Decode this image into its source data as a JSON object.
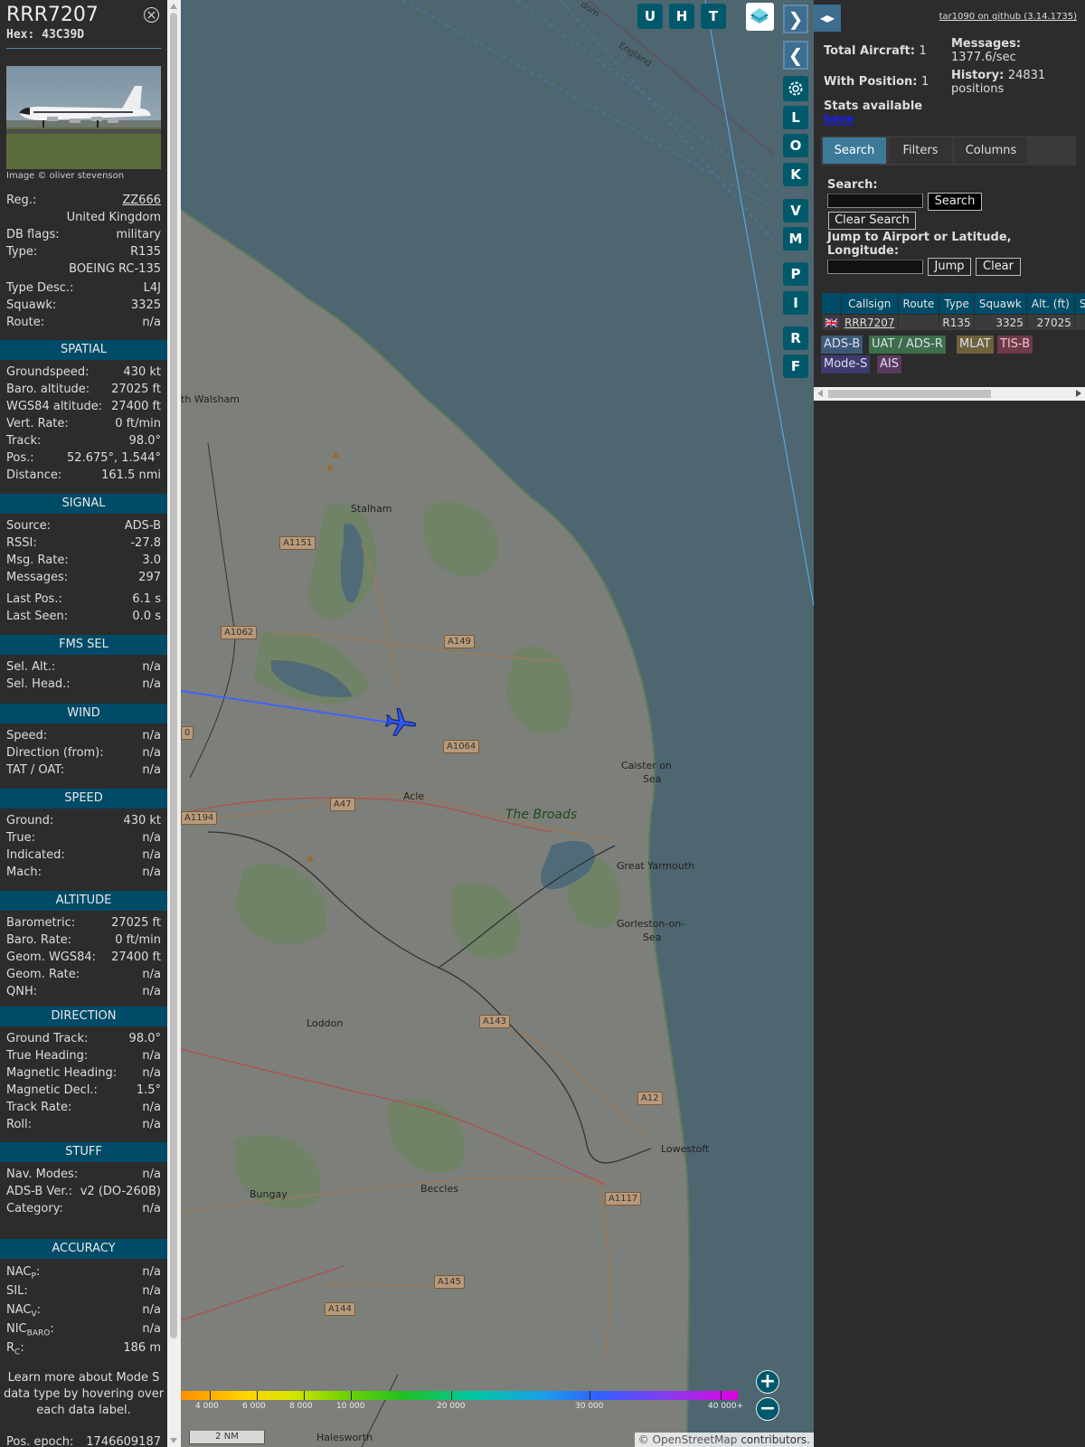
{
  "aircraft": {
    "callsign": "RRR7207",
    "hex_label": "Hex:",
    "hex": "43C39D",
    "photo_credit": "Image © oliver stevenson"
  },
  "details": [
    {
      "label": "Reg.:",
      "value": "ZZ666",
      "link": true
    },
    {
      "full": "United Kingdom"
    },
    {
      "label": "DB flags:",
      "value": "military"
    },
    {
      "label": "Type:",
      "value": "R135"
    },
    {
      "full": "BOEING RC-135"
    },
    {
      "label": "Type Desc.:",
      "value": "L4J"
    },
    {
      "label": "Squawk:",
      "value": "3325"
    },
    {
      "label": "Route:",
      "value": "n/a"
    }
  ],
  "sections": [
    {
      "title": "SPATIAL",
      "rows": [
        {
          "label": "Groundspeed:",
          "value": "430 kt"
        },
        {
          "label": "Baro. altitude:",
          "value": "27025 ft"
        },
        {
          "label": "WGS84 altitude:",
          "value": "27400 ft"
        },
        {
          "label": "Vert. Rate:",
          "value": "0 ft/min"
        },
        {
          "label": "Track:",
          "value": "98.0°"
        },
        {
          "label": "Pos.:",
          "value": "52.675°, 1.544°"
        },
        {
          "label": "Distance:",
          "value": "161.5 nmi"
        }
      ]
    },
    {
      "title": "SIGNAL",
      "rows": [
        {
          "label": "Source:",
          "value": "ADS-B"
        },
        {
          "label": "RSSI:",
          "value": "-27.8"
        },
        {
          "label": "Msg. Rate:",
          "value": "3.0"
        },
        {
          "label": "Messages:",
          "value": "297"
        },
        {
          "label": "Last Pos.:",
          "value": "6.1 s"
        },
        {
          "label": "Last Seen:",
          "value": "0.0 s"
        }
      ]
    },
    {
      "title": "FMS SEL",
      "rows": [
        {
          "label": "Sel. Alt.:",
          "value": "n/a"
        },
        {
          "label": "Sel. Head.:",
          "value": "n/a"
        }
      ]
    },
    {
      "title": "WIND",
      "rows": [
        {
          "label": "Speed:",
          "value": "n/a"
        },
        {
          "label": "Direction (from):",
          "value": "n/a"
        },
        {
          "label": "TAT / OAT:",
          "value": "n/a"
        }
      ]
    },
    {
      "title": "SPEED",
      "rows": [
        {
          "label": "Ground:",
          "value": "430 kt"
        },
        {
          "label": "True:",
          "value": "n/a"
        },
        {
          "label": "Indicated:",
          "value": "n/a"
        },
        {
          "label": "Mach:",
          "value": "n/a"
        }
      ]
    },
    {
      "title": "ALTITUDE",
      "rows": [
        {
          "label": "Barometric:",
          "value": "27025 ft"
        },
        {
          "label": "Baro. Rate:",
          "value": "0 ft/min"
        },
        {
          "label": "Geom. WGS84:",
          "value": "27400 ft"
        },
        {
          "label": "Geom. Rate:",
          "value": "n/a"
        },
        {
          "label": "QNH:",
          "value": "n/a"
        }
      ]
    },
    {
      "title": "DIRECTION",
      "rows": [
        {
          "label": "Ground Track:",
          "value": "98.0°"
        },
        {
          "label": "True Heading:",
          "value": "n/a"
        },
        {
          "label": "Magnetic Heading:",
          "value": "n/a"
        },
        {
          "label": "Magnetic Decl.:",
          "value": "1.5°"
        },
        {
          "label": "Track Rate:",
          "value": "n/a"
        },
        {
          "label": "Roll:",
          "value": "n/a"
        }
      ]
    },
    {
      "title": "STUFF",
      "rows": [
        {
          "label": "Nav. Modes:",
          "value": "n/a"
        },
        {
          "label": "ADS-B Ver.:",
          "value": "v2 (DO-260B)"
        },
        {
          "label": "Category:",
          "value": "n/a"
        }
      ]
    },
    {
      "title": "ACCURACY",
      "rows": [
        {
          "label": "NACP:",
          "value": "n/a"
        },
        {
          "label": "SIL:",
          "value": "n/a"
        },
        {
          "label": "NACV:",
          "value": "n/a"
        },
        {
          "label": "NICBARO:",
          "value": "n/a"
        },
        {
          "label": "RC:",
          "value": "186 m"
        }
      ]
    }
  ],
  "learn_more": "Learn more about Mode S data type by hovering over each data label.",
  "pos_epoch": {
    "label": "Pos. epoch:",
    "value": "1746609187"
  },
  "map": {
    "top_buttons": [
      "U",
      "H",
      "T"
    ],
    "side_buttons": [
      "L",
      "O",
      "K",
      "V",
      "M",
      "P",
      "I",
      "R",
      "F"
    ],
    "place_labels": [
      "th Walsham",
      "Stalham",
      "Acle",
      "Caister on",
      "Sea",
      "Great Yarmouth",
      "Gorleston-on-",
      "Sea",
      "Loddon",
      "Lowestoft",
      "Bungay",
      "Beccles",
      "Halesworth",
      "The Broads",
      "England",
      "dom"
    ],
    "road_labels": [
      "A1151",
      "A1062",
      "A149",
      "A1064",
      "A47",
      "A1194",
      "A143",
      "A12",
      "A1117",
      "A145",
      "A144",
      "0"
    ],
    "altitude_scale": [
      "4 000",
      "6 000",
      "8 000",
      "10 000",
      "20 000",
      "30 000",
      "40 000+"
    ],
    "scale_bar": "2 NM",
    "attribution_link": "© OpenStreetMap",
    "attribution_rest": " contributors."
  },
  "right_panel": {
    "github_link": "tar1090 on github (3.14.1735)",
    "total_aircraft_label": "Total Aircraft:",
    "total_aircraft": "1",
    "with_position_label": "With Position:",
    "with_position": "1",
    "messages_label": "Messages:",
    "messages_rate": "1377.6/sec",
    "history_label": "History:",
    "history_value": "24831",
    "history_unit": "positions",
    "stats_text": "Stats available",
    "stats_link": "here",
    "tabs": [
      "Search",
      "Filters",
      "Columns"
    ],
    "search_label": "Search:",
    "search_button": "Search",
    "clear_search_button": "Clear Search",
    "jump_label_1": "Jump to Airport or Latitude,",
    "jump_label_2": "Longitude:",
    "jump_button": "Jump",
    "clear_button": "Clear",
    "table_headers": [
      "",
      "Callsign",
      "Route",
      "Type",
      "Squawk",
      "Alt. (ft)",
      "Spd"
    ],
    "table_rows": [
      {
        "flag": "🇬🇧",
        "callsign": "RRR7207",
        "route": "",
        "type": "R135",
        "squawk": "3325",
        "alt": "27025",
        "spd": ""
      }
    ],
    "sources": [
      {
        "label": "ADS-B",
        "color": "#3c5a78",
        "text": "#dde"
      },
      {
        "label": "UAT / ADS-R",
        "color": "#3c6e4a",
        "text": "#dde"
      },
      {
        "label": "MLAT",
        "color": "#6e623a",
        "text": "#dde"
      },
      {
        "label": "TIS-B",
        "color": "#6e3a4a",
        "text": "#f0c0c8"
      },
      {
        "label": "Mode-S",
        "color": "#3e3a6e",
        "text": "#dde"
      },
      {
        "label": "AIS",
        "color": "#5a3a5e",
        "text": "#dde"
      }
    ]
  }
}
